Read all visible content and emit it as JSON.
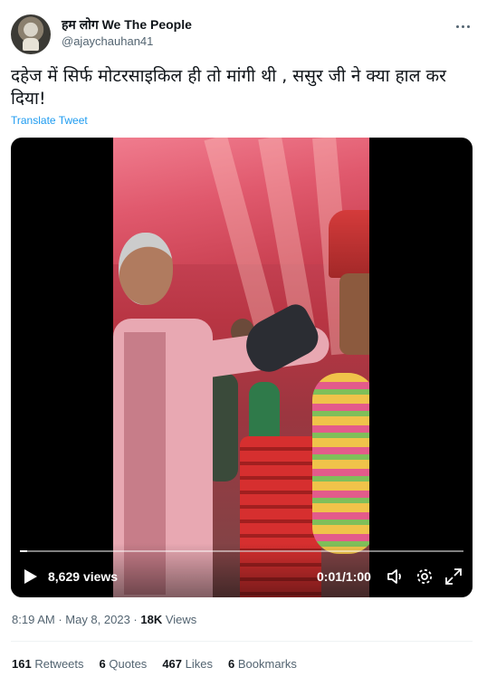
{
  "author": {
    "display_name": "हम लोग We The People",
    "handle": "@ajaychauhan41",
    "avatar_icon": "avatar"
  },
  "tweet": {
    "text": "दहेज में सिर्फ मोटरसाइकिल ही तो मांगी थी , ससुर जी ने क्या हाल कर दिया!",
    "translate_label": "Translate Tweet"
  },
  "video": {
    "views_count": "8,629",
    "views_label": "views",
    "elapsed": "0:01",
    "duration": "1:00",
    "progress_fraction": 0.017,
    "icons": [
      "play-icon",
      "volume-icon",
      "settings-icon",
      "fullscreen-icon"
    ]
  },
  "meta": {
    "time": "8:19 AM",
    "date": "May 8, 2023",
    "views_count": "18K",
    "views_label": "Views"
  },
  "stats": [
    {
      "count": "161",
      "label": "Retweets"
    },
    {
      "count": "6",
      "label": "Quotes"
    },
    {
      "count": "467",
      "label": "Likes"
    },
    {
      "count": "6",
      "label": "Bookmarks"
    }
  ],
  "colors": {
    "link": "#1d9bf0",
    "secondary_text": "#536471",
    "primary_text": "#0f1419"
  }
}
